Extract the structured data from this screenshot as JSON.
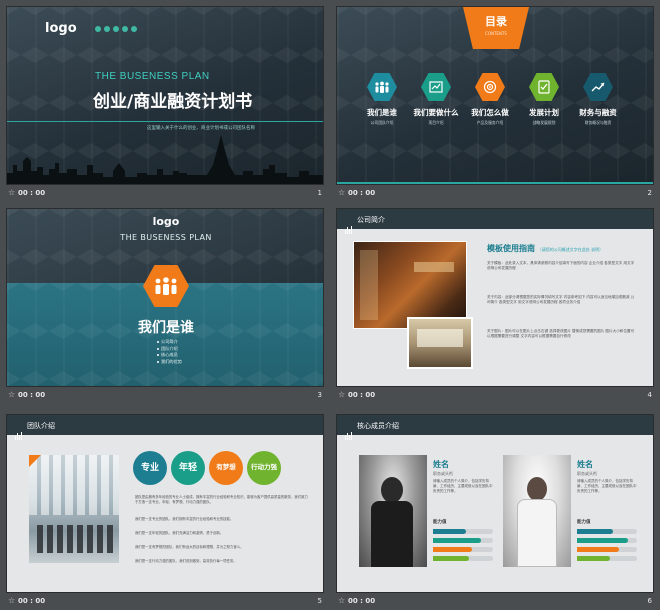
{
  "captions": {
    "star": "☆",
    "time": "00 : 00"
  },
  "slide1": {
    "number": "1",
    "logo": "logo",
    "subtitle": "THE BUSENESS PLAN",
    "title": "创业/商业融资计划书",
    "tagline": "这里输入关于什么的创业、商业计划书或公司团队名称"
  },
  "slide2": {
    "number": "2",
    "tab_title": "目录",
    "tab_sub": "CONTENTS",
    "items": [
      {
        "title": "我们是谁",
        "sub": "公司团队介绍",
        "color": "#1f8da0",
        "icon": "team-icon"
      },
      {
        "title": "我们要做什么",
        "sub": "项目介绍",
        "color": "#1a9e8a",
        "icon": "chart-icon"
      },
      {
        "title": "我们怎么做",
        "sub": "产品及服务介绍",
        "color": "#f07b18",
        "icon": "target-icon"
      },
      {
        "title": "发展计划",
        "sub": "战略发展规划",
        "color": "#6fb32e",
        "icon": "checklist-icon"
      },
      {
        "title": "财务与融资",
        "sub": "财务概况与融资",
        "color": "#175a6e",
        "icon": "trend-icon"
      }
    ]
  },
  "slide3": {
    "number": "3",
    "logo": "logo",
    "subtitle": "THE BUSENESS PLAN",
    "title": "我们是谁",
    "bullets": [
      "公司简介",
      "团队介绍",
      "核心成员",
      "我们的优势"
    ]
  },
  "slide4": {
    "number": "4",
    "header": "公司简介",
    "heading": "模板使用指南",
    "heading_note": "（请您的公司概述文字在此处 说明）",
    "paragraphs": [
      "关于模板：此处录入文本，具体请参照内容介绍填写下面的内容 企业介绍 各类型文字 用文字说明公司发展历程",
      "关于内容：此部分请根据您的实际情况填写文字 内容参考如下 内容可以适当地增加或删减 公司简介 各类型文字 用文字说明公司发展历程 各项业务介绍",
      "关于图片：图片可以在图片上点击右键 选择更改图片 替换成您需要的图片 图片大小和位置可以根据需要进行调整 文字内容可以根据需要自行修改"
    ]
  },
  "slide5": {
    "number": "5",
    "header": "团队介绍",
    "circles": [
      {
        "label": "专业",
        "color": "#1c7e90"
      },
      {
        "label": "年轻",
        "color": "#1a9e8a"
      },
      {
        "label": "有梦想",
        "color": "#f07b18"
      },
      {
        "label": "行动力强",
        "color": "#6fb32e"
      }
    ],
    "paragraphs": [
      "团队是由拥有多年经验的专业人士组成，拥有丰富的行业经验和专业知识，能够为客户提供高质量的服务，我们致力于打造一支专业、年轻、有梦想、行动力强的团队。",
      "我们是一支专业的团队，我们拥有丰富的行业经验和专业的技能。",
      "我们是一支年轻的团队，我们充满活力和激情，勇于创新。",
      "我们是一支有梦想的团队，我们有远大的目标和理想，并为之努力奋斗。",
      "我们是一支行动力强的团队，我们说到做到，高效执行每一项任务。"
    ]
  },
  "slide6": {
    "number": "6",
    "header": "核心成员介绍",
    "members": [
      {
        "name": "姓名",
        "role": "职务或头衔",
        "bio": "请输入成员的个人简介，包括学历背景、工作经历、主要成就以及在团队中负责的工作等。",
        "ability_label": "能力值",
        "bars": [
          0.55,
          0.8,
          0.65,
          0.6
        ]
      },
      {
        "name": "姓名",
        "role": "职务或头衔",
        "bio": "请输入成员的个人简介，包括学历背景、工作经历、主要成就以及在团队中负责的工作等。",
        "ability_label": "能力值",
        "bars": [
          0.6,
          0.85,
          0.7,
          0.55
        ]
      }
    ],
    "bar_colors": [
      "#1c7e90",
      "#1a9e8a",
      "#f07b18",
      "#6fb32e"
    ]
  }
}
